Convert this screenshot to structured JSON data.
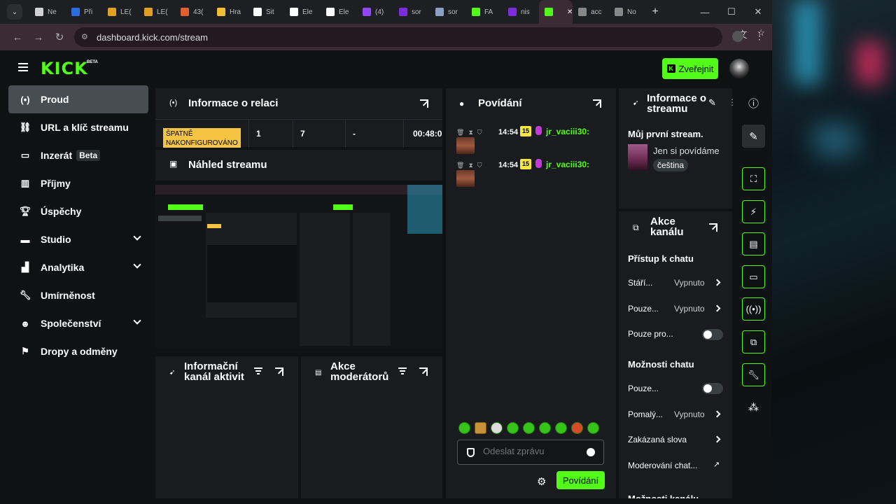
{
  "browser": {
    "tabs": [
      {
        "label": "Ne",
        "color": "#d0d0d0"
      },
      {
        "label": "Při",
        "color": "#2b6de0"
      },
      {
        "label": "LE(",
        "color": "#e0a020"
      },
      {
        "label": "LE(",
        "color": "#e0a020"
      },
      {
        "label": "43(",
        "color": "#e06030"
      },
      {
        "label": "Hra",
        "color": "#f0c030"
      },
      {
        "label": "Sit",
        "color": "#ffffff"
      },
      {
        "label": "Ele",
        "color": "#ffffff"
      },
      {
        "label": "Ele",
        "color": "#ffffff"
      },
      {
        "label": "(4)",
        "color": "#9146ff"
      },
      {
        "label": "sor",
        "color": "#7b2cdc"
      },
      {
        "label": "sor",
        "color": "#8aa0c0"
      },
      {
        "label": "FA",
        "color": "#53fc18"
      },
      {
        "label": "nis",
        "color": "#7b2cdc"
      },
      {
        "label": "",
        "color": "#53fc18"
      },
      {
        "label": "acc",
        "color": "#888888"
      },
      {
        "label": "No",
        "color": "#888888"
      }
    ],
    "url": "dashboard.kick.com/stream"
  },
  "header": {
    "logo": "KICK",
    "logo_badge": "BETA",
    "publish_label": "Zveřejnit"
  },
  "sidebar": {
    "items": [
      {
        "label": "Proud",
        "icon": "broadcast-icon"
      },
      {
        "label": "URL a klíč streamu",
        "icon": "link-icon"
      },
      {
        "label": "Inzerát",
        "icon": "ad-icon",
        "badge": "Beta"
      },
      {
        "label": "Příjmy",
        "icon": "revenue-icon"
      },
      {
        "label": "Úspěchy",
        "icon": "trophy-icon"
      },
      {
        "label": "Studio",
        "icon": "studio-icon"
      },
      {
        "label": "Analytika",
        "icon": "analytics-icon"
      },
      {
        "label": "Umírněnost",
        "icon": "wrench-icon"
      },
      {
        "label": "Společenství",
        "icon": "community-icon"
      },
      {
        "label": "Dropy a odměny",
        "icon": "drops-icon"
      }
    ]
  },
  "session": {
    "title": "Informace o relaci",
    "status": "ŠPATNĚ NAKONFIGUROVÁNO",
    "values": [
      "1",
      "7",
      "-",
      "00:48:0"
    ]
  },
  "preview": {
    "title": "Náhled streamu"
  },
  "activity_feed": {
    "title": "Informační kanál aktivit"
  },
  "mod_actions": {
    "title": "Akce moderátorů"
  },
  "chat": {
    "title": "Povídání",
    "messages": [
      {
        "time": "14:54",
        "badge": "15",
        "user": "jr_vaciii30:"
      },
      {
        "time": "14:54",
        "badge": "15",
        "user": "jr_vaciii30:"
      }
    ],
    "input_placeholder": "Odeslat zprávu",
    "send_label": "Povídání"
  },
  "stream_info": {
    "title": "Informace o streamu",
    "stream_title": "Můj první stream.",
    "category": "Jen si povídáme",
    "language": "čeština"
  },
  "channel_actions": {
    "title": "Akce kanálu",
    "chat_access_title": "Přístup k chatu",
    "chat_access": [
      {
        "label": "Stáří...",
        "value": "Vypnuto"
      },
      {
        "label": "Pouze...",
        "value": "Vypnuto"
      },
      {
        "label": "Pouze pro...",
        "value": ""
      }
    ],
    "chat_options_title": "Možnosti chatu",
    "chat_options": [
      {
        "label": "Pouze...",
        "value": ""
      },
      {
        "label": "Pomalý...",
        "value": "Vypnuto"
      },
      {
        "label": "Zakázaná slova",
        "value": ""
      },
      {
        "label": "Moderování chat...",
        "value": ""
      }
    ],
    "cut_off_title": "Možnosti kanálu"
  },
  "colors": {
    "accent": "#53fc18",
    "warning": "#f5c442",
    "panel": "#191b1f",
    "page": "#0f1213"
  }
}
